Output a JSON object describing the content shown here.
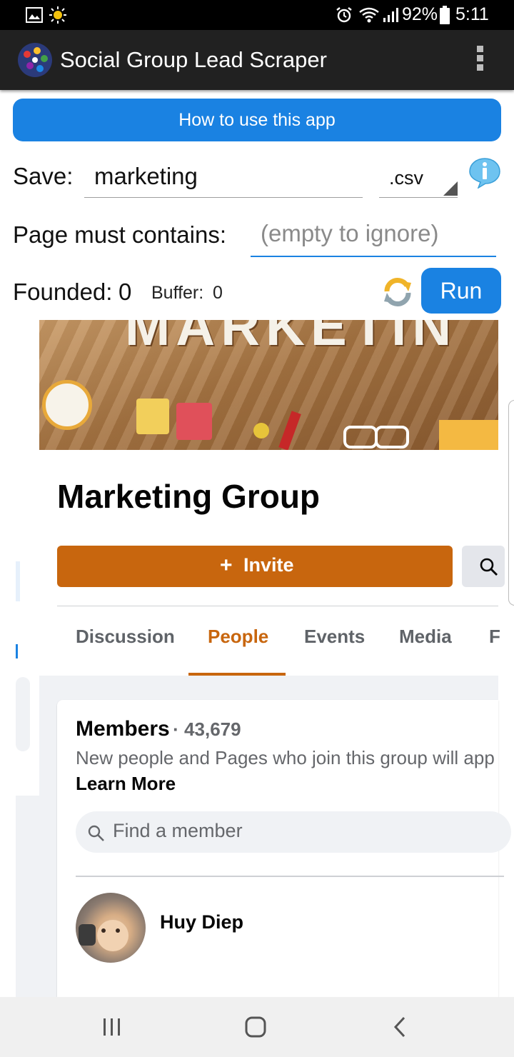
{
  "status_bar": {
    "battery": "92%",
    "time": "5:11"
  },
  "app_bar": {
    "title": "Social Group Lead Scraper"
  },
  "howto_label": "How to use this app",
  "save": {
    "label": "Save:",
    "value": "marketing",
    "extension": ".csv"
  },
  "contains": {
    "label": "Page must contains:",
    "placeholder": "(empty to ignore)"
  },
  "founded": {
    "label": "Founded:",
    "value": "0"
  },
  "buffer": {
    "label": "Buffer:",
    "value": "0"
  },
  "run_label": "Run",
  "web": {
    "cover_text": "MARKETIN",
    "group_name": "Marketing Group",
    "invite_label": "Invite",
    "tabs": [
      "Discussion",
      "People",
      "Events",
      "Media",
      "F"
    ],
    "active_tab": "People",
    "members_heading": "Members",
    "members_count": "· 43,679",
    "members_desc": "New people and Pages who join this group will app",
    "learn_more": "Learn More",
    "find_placeholder": "Find a member",
    "member_name": "Huy Diep"
  },
  "colors": {
    "accent_blue": "#1a82e2",
    "fb_orange": "#c8660e",
    "app_bar": "#212121"
  },
  "icons": [
    "gallery-icon",
    "sun-icon",
    "alarm-icon",
    "wifi-icon",
    "signal-icon",
    "battery-icon",
    "app-logo-icon",
    "more-vert-icon",
    "info-icon",
    "refresh-icon",
    "plus-icon",
    "search-icon",
    "recent-apps-icon",
    "home-icon",
    "back-icon"
  ]
}
